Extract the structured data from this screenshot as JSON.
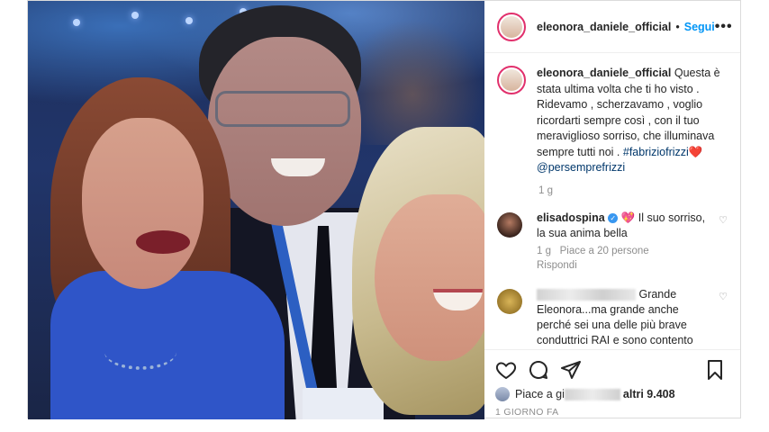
{
  "header": {
    "username": "eleonora_daniele_official",
    "separator": "•",
    "follow_label": "Segui",
    "more_label": "•••"
  },
  "caption": {
    "username": "eleonora_daniele_official",
    "text": "Questa è stata ultima volta che ti ho visto . Ridevamo , scherzavamo , voglio ricordarti sempre così , con il tuo meraviglioso sorriso, che illuminava sempre tutti noi . ",
    "hashtag": "#fabriziofrizzi",
    "emoji": "❤️",
    "mention": "@persemprefrizzi",
    "time": "1 g"
  },
  "comments": [
    {
      "username": "elisadospina",
      "verified_mark": "✓",
      "emoji": "💖",
      "text": " Il suo sorriso, la sua anima bella",
      "time": "1 g",
      "likes": "Piace a 20 persone",
      "reply_label": "Rispondi"
    },
    {
      "text_tail": " Grande Eleonora...ma grande anche perché sei una delle più brave conduttrici RAI e sono contento"
    }
  ],
  "actions": {
    "like": "heart-icon",
    "comment": "comment-icon",
    "share": "share-icon",
    "save": "bookmark-icon"
  },
  "likes_summary": {
    "prefix": "Piace a gi",
    "suffix": "altri 9.408"
  },
  "date": "1 GIORNO FA",
  "colors": {
    "link": "#00376b",
    "follow": "#0095f6",
    "muted": "#8e8e8e"
  }
}
